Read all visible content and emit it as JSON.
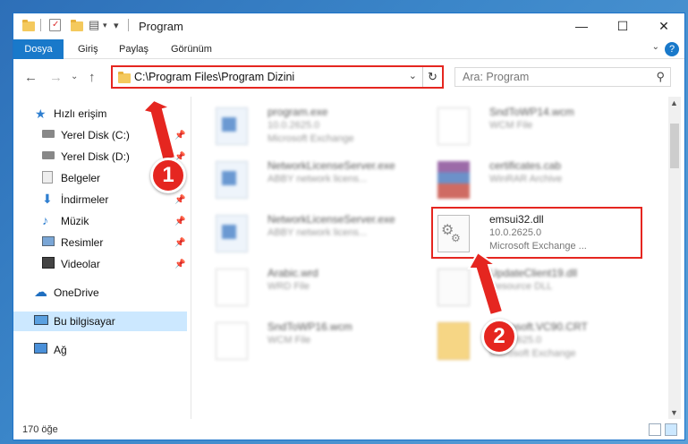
{
  "window": {
    "title": "Program"
  },
  "ribbon": {
    "tabs": [
      "Dosya",
      "Giriş",
      "Paylaş",
      "Görünüm"
    ],
    "help": "?"
  },
  "address": {
    "path": "C:\\Program Files\\Program Dizini",
    "search_placeholder": "Ara: Program"
  },
  "nav": {
    "items": [
      {
        "label": "Hızlı erişim",
        "icon": "star-icon",
        "pinned": false
      },
      {
        "label": "Yerel Disk (C:)",
        "icon": "drive-icon",
        "pinned": true
      },
      {
        "label": "Yerel Disk (D:)",
        "icon": "drive-icon",
        "pinned": true
      },
      {
        "label": "Belgeler",
        "icon": "documents-icon",
        "pinned": true
      },
      {
        "label": "İndirmeler",
        "icon": "download-icon",
        "pinned": true
      },
      {
        "label": "Müzik",
        "icon": "music-icon",
        "pinned": true
      },
      {
        "label": "Resimler",
        "icon": "pictures-icon",
        "pinned": true
      },
      {
        "label": "Videolar",
        "icon": "videos-icon",
        "pinned": true
      },
      {
        "label": "OneDrive",
        "icon": "cloud-icon",
        "pinned": false
      },
      {
        "label": "Bu bilgisayar",
        "icon": "computer-icon",
        "pinned": false,
        "selected": true
      },
      {
        "label": "Ağ",
        "icon": "network-icon",
        "pinned": false
      }
    ]
  },
  "files": [
    {
      "name": "program.exe",
      "line2": "10.0.2625.0",
      "line3": "Microsoft Exchange",
      "icon": "exe-icon"
    },
    {
      "name": "SndToWP14.wcm",
      "line2": "WCM File",
      "line3": "",
      "icon": "document-icon"
    },
    {
      "name": "NetworkLicenseServer.exe",
      "line2": "ABBY network licens...",
      "line3": "",
      "icon": "exe-icon"
    },
    {
      "name": "certificates.cab",
      "line2": "WinRAR Archive",
      "line3": "",
      "icon": "archive-icon"
    },
    {
      "name": "NetworkLicenseServer.exe",
      "line2": "ABBY network licens...",
      "line3": "",
      "icon": "exe-icon"
    },
    {
      "name": "emsui32.dll",
      "line2": "10.0.2625.0",
      "line3": "Microsoft Exchange ...",
      "icon": "dll-icon"
    },
    {
      "name": "Arabic.wrd",
      "line2": "WRD File",
      "line3": "",
      "icon": "document-icon"
    },
    {
      "name": "UpdateClient19.dll",
      "line2": "Resource DLL",
      "line3": "",
      "icon": "dll-icon"
    },
    {
      "name": "SndToWP16.wcm",
      "line2": "WCM File",
      "line3": "",
      "icon": "document-icon"
    },
    {
      "name": "Microsoft.VC90.CRT",
      "line2": "10.0.2625.0",
      "line3": "Microsoft Exchange",
      "icon": "folder-icon"
    }
  ],
  "status": {
    "count": "170 öğe"
  },
  "annotations": {
    "badge1": "1",
    "badge2": "2"
  },
  "colors": {
    "accent": "#1979ca",
    "annotation": "#e52620",
    "selected": "#cce8ff"
  }
}
